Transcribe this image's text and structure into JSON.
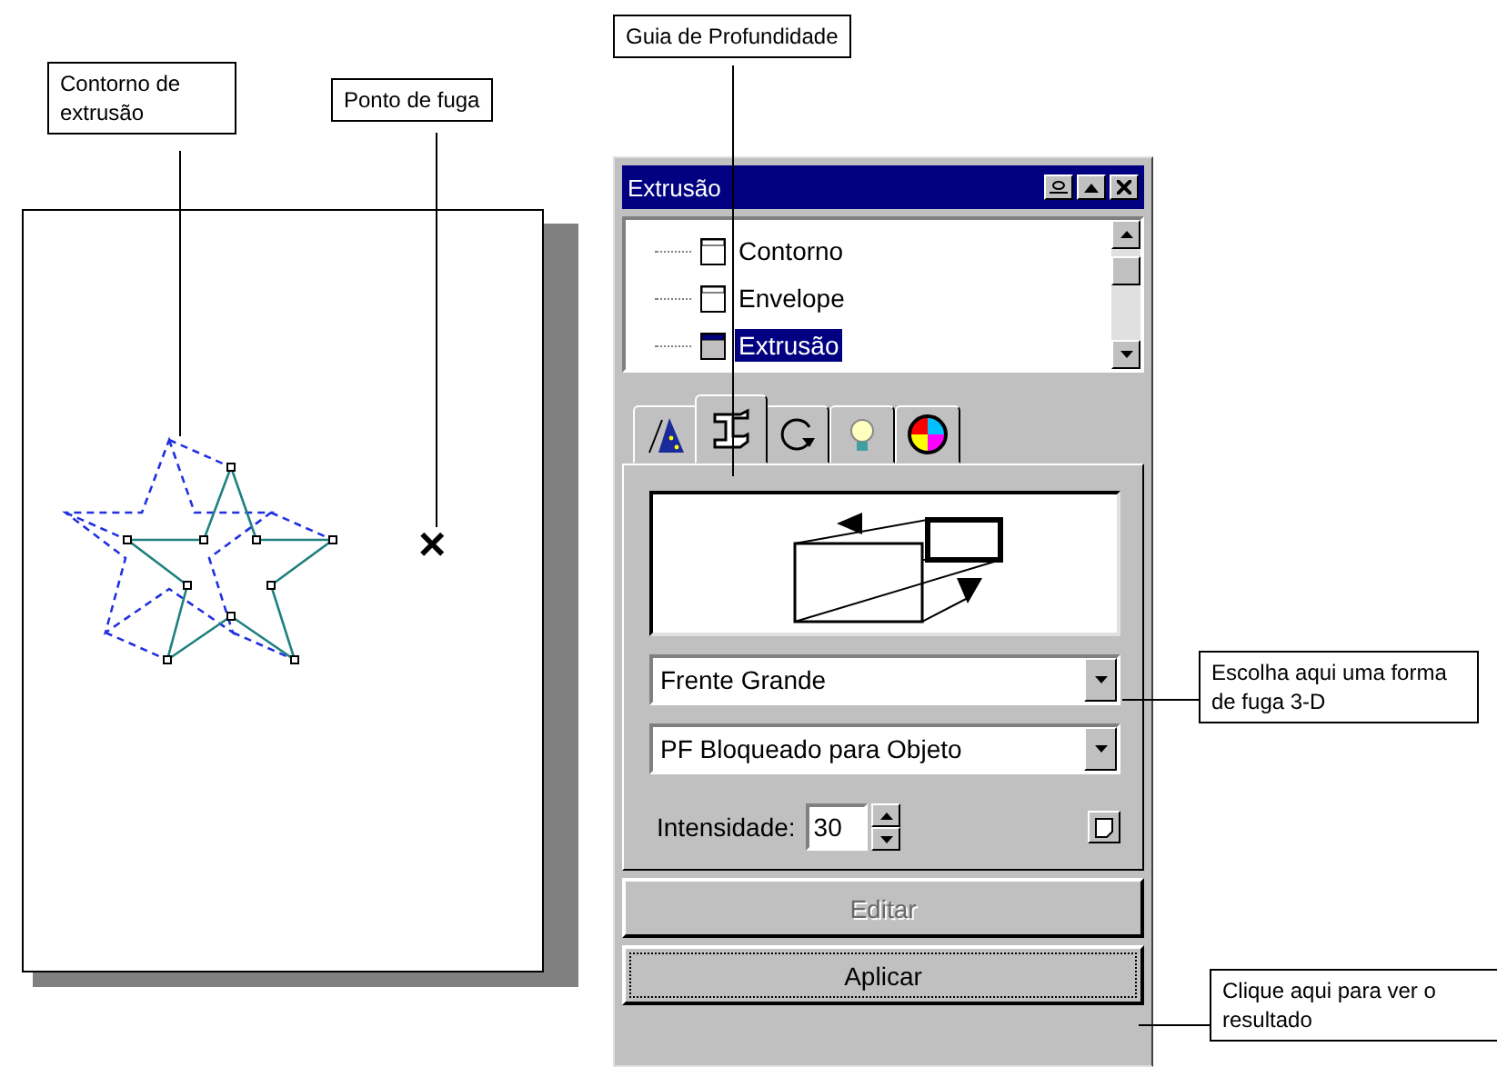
{
  "callouts": {
    "extrusion_contour": "Contorno de extrusão",
    "vanishing_point": "Ponto de fuga",
    "depth_guide": "Guia de Profundidade",
    "vanishing_form": "Escolha aqui uma forma de fuga 3-D",
    "apply_hint": "Clique aqui para ver o resultado"
  },
  "canvas": {
    "vanishing_mark": "×"
  },
  "docker": {
    "title": "Extrusão",
    "tree": [
      {
        "label": "Contorno",
        "selected": false
      },
      {
        "label": "Envelope",
        "selected": false
      },
      {
        "label": "Extrusão",
        "selected": true
      }
    ],
    "tabs": [
      {
        "kind": "wizard",
        "selected": false
      },
      {
        "kind": "depth",
        "selected": true
      },
      {
        "kind": "rotate",
        "selected": false
      },
      {
        "kind": "light",
        "selected": false
      },
      {
        "kind": "color",
        "selected": false
      }
    ],
    "dropdowns": [
      {
        "value": "Frente Grande"
      },
      {
        "value": "PF Bloqueado para Objeto"
      }
    ],
    "depth": {
      "label": "Intensidade:",
      "value": "30"
    },
    "buttons": [
      {
        "label": "Editar",
        "disabled": true,
        "focused": false
      },
      {
        "label": "Aplicar",
        "disabled": false,
        "focused": true
      }
    ]
  }
}
